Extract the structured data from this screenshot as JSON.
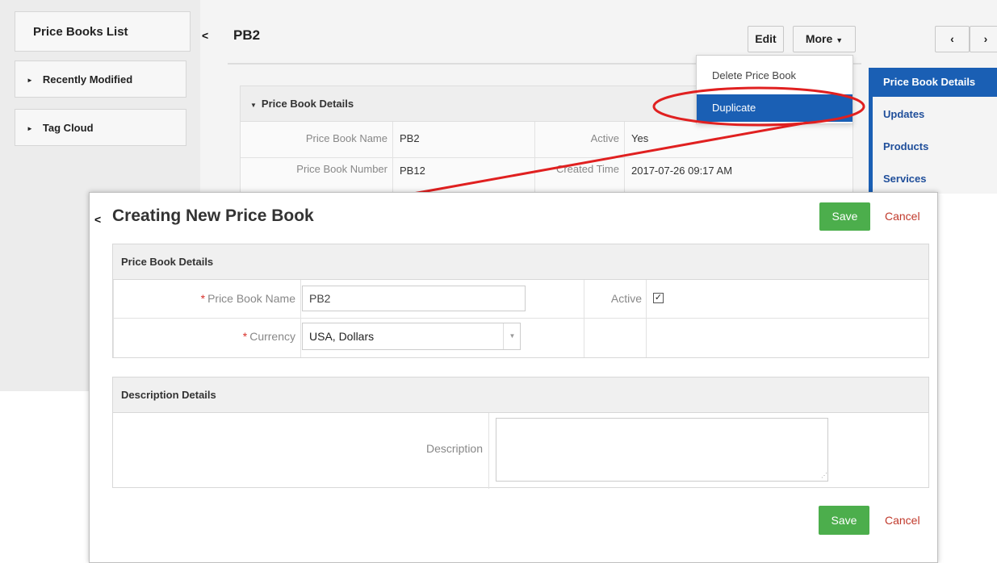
{
  "sidebar": {
    "title": "Price Books List",
    "items": [
      {
        "label": "Recently Modified"
      },
      {
        "label": "Tag Cloud"
      }
    ]
  },
  "header": {
    "record_title": "PB2",
    "edit_label": "Edit",
    "more_label": "More",
    "prev_symbol": "‹",
    "next_symbol": "›"
  },
  "more_menu": {
    "items": [
      "Delete Price Book",
      "Duplicate"
    ]
  },
  "details": {
    "section_title": "Price Book Details",
    "rows": [
      {
        "label": "Price Book Name",
        "value": "PB2",
        "label2": "Active",
        "value2": "Yes"
      },
      {
        "label": "Price Book Number",
        "value": "PB12",
        "label2": "Created Time",
        "value2": "2017-07-26 09:17 AM"
      }
    ]
  },
  "related": {
    "items": [
      "Price Book Details",
      "Updates",
      "Products",
      "Services"
    ]
  },
  "modal": {
    "title": "Creating New Price Book",
    "save_label": "Save",
    "cancel_label": "Cancel",
    "section_price_book": "Price Book Details",
    "price_book_name_label": "Price Book Name",
    "price_book_name_value": "PB2",
    "currency_label": "Currency",
    "currency_value": "USA, Dollars",
    "active_label": "Active",
    "active_checked": true,
    "section_description": "Description Details",
    "description_label": "Description",
    "description_value": ""
  },
  "colors": {
    "accent_blue": "#1a5fb4",
    "save_green": "#4cae4c",
    "cancel_red": "#c0392b",
    "annotation_red": "#e02020"
  }
}
